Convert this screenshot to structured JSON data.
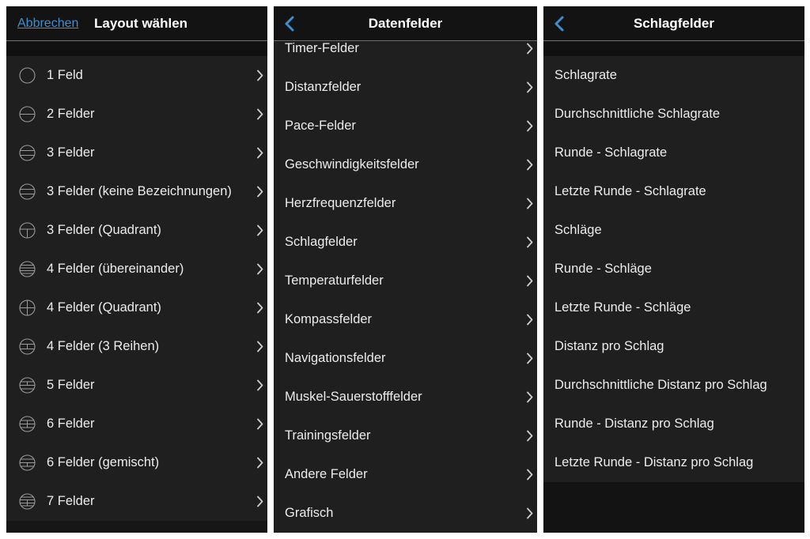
{
  "colors": {
    "accent": "#3e8ed0",
    "background": "#161616",
    "row": "#1f1f1f",
    "text": "#ececec"
  },
  "screen1": {
    "cancel_label": "Abbrechen",
    "title": "Layout wählen",
    "items": [
      {
        "label": "1 Feld",
        "icon": "layout-1-field-icon"
      },
      {
        "label": "2 Felder",
        "icon": "layout-2-fields-icon"
      },
      {
        "label": "3 Felder",
        "icon": "layout-3-fields-icon"
      },
      {
        "label": "3 Felder (keine Bezeichnungen)",
        "icon": "layout-3-fields-no-labels-icon"
      },
      {
        "label": "3 Felder (Quadrant)",
        "icon": "layout-3-fields-quadrant-icon"
      },
      {
        "label": "4 Felder (übereinander)",
        "icon": "layout-4-fields-stacked-icon"
      },
      {
        "label": "4 Felder (Quadrant)",
        "icon": "layout-4-fields-quadrant-icon"
      },
      {
        "label": "4 Felder (3 Reihen)",
        "icon": "layout-4-fields-3-rows-icon"
      },
      {
        "label": "5 Felder",
        "icon": "layout-5-fields-icon"
      },
      {
        "label": "6 Felder",
        "icon": "layout-6-fields-icon"
      },
      {
        "label": "6 Felder (gemischt)",
        "icon": "layout-6-fields-mixed-icon"
      },
      {
        "label": "7 Felder",
        "icon": "layout-7-fields-icon"
      }
    ]
  },
  "screen2": {
    "title": "Datenfelder",
    "back_icon": "chevron-left-icon",
    "items": [
      {
        "label": "Timer-Felder"
      },
      {
        "label": "Distanzfelder"
      },
      {
        "label": "Pace-Felder"
      },
      {
        "label": "Geschwindigkeitsfelder"
      },
      {
        "label": "Herzfrequenzfelder"
      },
      {
        "label": "Schlagfelder"
      },
      {
        "label": "Temperaturfelder"
      },
      {
        "label": "Kompassfelder"
      },
      {
        "label": "Navigationsfelder"
      },
      {
        "label": "Muskel-Sauerstofffelder"
      },
      {
        "label": "Trainingsfelder"
      },
      {
        "label": "Andere Felder"
      },
      {
        "label": "Grafisch"
      }
    ]
  },
  "screen3": {
    "title": "Schlagfelder",
    "back_icon": "chevron-left-icon",
    "items": [
      {
        "label": "Schlagrate"
      },
      {
        "label": "Durchschnittliche Schlagrate"
      },
      {
        "label": "Runde - Schlagrate"
      },
      {
        "label": "Letzte Runde - Schlagrate"
      },
      {
        "label": "Schläge"
      },
      {
        "label": "Runde - Schläge"
      },
      {
        "label": "Letzte Runde - Schläge"
      },
      {
        "label": "Distanz pro Schlag"
      },
      {
        "label": "Durchschnittliche Distanz pro Schlag"
      },
      {
        "label": "Runde - Distanz pro Schlag"
      },
      {
        "label": "Letzte Runde - Distanz pro Schlag"
      }
    ]
  }
}
